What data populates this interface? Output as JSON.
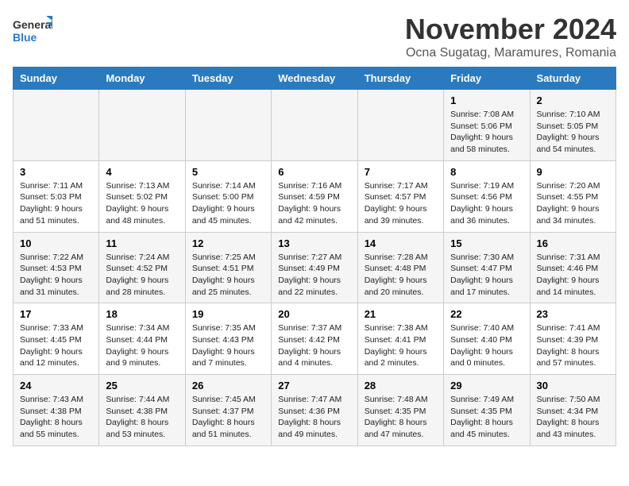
{
  "logo": {
    "line1": "General",
    "line2": "Blue"
  },
  "title": "November 2024",
  "subtitle": "Ocna Sugatag, Maramures, Romania",
  "days_of_week": [
    "Sunday",
    "Monday",
    "Tuesday",
    "Wednesday",
    "Thursday",
    "Friday",
    "Saturday"
  ],
  "weeks": [
    [
      {
        "day": "",
        "info": ""
      },
      {
        "day": "",
        "info": ""
      },
      {
        "day": "",
        "info": ""
      },
      {
        "day": "",
        "info": ""
      },
      {
        "day": "",
        "info": ""
      },
      {
        "day": "1",
        "info": "Sunrise: 7:08 AM\nSunset: 5:06 PM\nDaylight: 9 hours and 58 minutes."
      },
      {
        "day": "2",
        "info": "Sunrise: 7:10 AM\nSunset: 5:05 PM\nDaylight: 9 hours and 54 minutes."
      }
    ],
    [
      {
        "day": "3",
        "info": "Sunrise: 7:11 AM\nSunset: 5:03 PM\nDaylight: 9 hours and 51 minutes."
      },
      {
        "day": "4",
        "info": "Sunrise: 7:13 AM\nSunset: 5:02 PM\nDaylight: 9 hours and 48 minutes."
      },
      {
        "day": "5",
        "info": "Sunrise: 7:14 AM\nSunset: 5:00 PM\nDaylight: 9 hours and 45 minutes."
      },
      {
        "day": "6",
        "info": "Sunrise: 7:16 AM\nSunset: 4:59 PM\nDaylight: 9 hours and 42 minutes."
      },
      {
        "day": "7",
        "info": "Sunrise: 7:17 AM\nSunset: 4:57 PM\nDaylight: 9 hours and 39 minutes."
      },
      {
        "day": "8",
        "info": "Sunrise: 7:19 AM\nSunset: 4:56 PM\nDaylight: 9 hours and 36 minutes."
      },
      {
        "day": "9",
        "info": "Sunrise: 7:20 AM\nSunset: 4:55 PM\nDaylight: 9 hours and 34 minutes."
      }
    ],
    [
      {
        "day": "10",
        "info": "Sunrise: 7:22 AM\nSunset: 4:53 PM\nDaylight: 9 hours and 31 minutes."
      },
      {
        "day": "11",
        "info": "Sunrise: 7:24 AM\nSunset: 4:52 PM\nDaylight: 9 hours and 28 minutes."
      },
      {
        "day": "12",
        "info": "Sunrise: 7:25 AM\nSunset: 4:51 PM\nDaylight: 9 hours and 25 minutes."
      },
      {
        "day": "13",
        "info": "Sunrise: 7:27 AM\nSunset: 4:49 PM\nDaylight: 9 hours and 22 minutes."
      },
      {
        "day": "14",
        "info": "Sunrise: 7:28 AM\nSunset: 4:48 PM\nDaylight: 9 hours and 20 minutes."
      },
      {
        "day": "15",
        "info": "Sunrise: 7:30 AM\nSunset: 4:47 PM\nDaylight: 9 hours and 17 minutes."
      },
      {
        "day": "16",
        "info": "Sunrise: 7:31 AM\nSunset: 4:46 PM\nDaylight: 9 hours and 14 minutes."
      }
    ],
    [
      {
        "day": "17",
        "info": "Sunrise: 7:33 AM\nSunset: 4:45 PM\nDaylight: 9 hours and 12 minutes."
      },
      {
        "day": "18",
        "info": "Sunrise: 7:34 AM\nSunset: 4:44 PM\nDaylight: 9 hours and 9 minutes."
      },
      {
        "day": "19",
        "info": "Sunrise: 7:35 AM\nSunset: 4:43 PM\nDaylight: 9 hours and 7 minutes."
      },
      {
        "day": "20",
        "info": "Sunrise: 7:37 AM\nSunset: 4:42 PM\nDaylight: 9 hours and 4 minutes."
      },
      {
        "day": "21",
        "info": "Sunrise: 7:38 AM\nSunset: 4:41 PM\nDaylight: 9 hours and 2 minutes."
      },
      {
        "day": "22",
        "info": "Sunrise: 7:40 AM\nSunset: 4:40 PM\nDaylight: 9 hours and 0 minutes."
      },
      {
        "day": "23",
        "info": "Sunrise: 7:41 AM\nSunset: 4:39 PM\nDaylight: 8 hours and 57 minutes."
      }
    ],
    [
      {
        "day": "24",
        "info": "Sunrise: 7:43 AM\nSunset: 4:38 PM\nDaylight: 8 hours and 55 minutes."
      },
      {
        "day": "25",
        "info": "Sunrise: 7:44 AM\nSunset: 4:38 PM\nDaylight: 8 hours and 53 minutes."
      },
      {
        "day": "26",
        "info": "Sunrise: 7:45 AM\nSunset: 4:37 PM\nDaylight: 8 hours and 51 minutes."
      },
      {
        "day": "27",
        "info": "Sunrise: 7:47 AM\nSunset: 4:36 PM\nDaylight: 8 hours and 49 minutes."
      },
      {
        "day": "28",
        "info": "Sunrise: 7:48 AM\nSunset: 4:35 PM\nDaylight: 8 hours and 47 minutes."
      },
      {
        "day": "29",
        "info": "Sunrise: 7:49 AM\nSunset: 4:35 PM\nDaylight: 8 hours and 45 minutes."
      },
      {
        "day": "30",
        "info": "Sunrise: 7:50 AM\nSunset: 4:34 PM\nDaylight: 8 hours and 43 minutes."
      }
    ]
  ]
}
